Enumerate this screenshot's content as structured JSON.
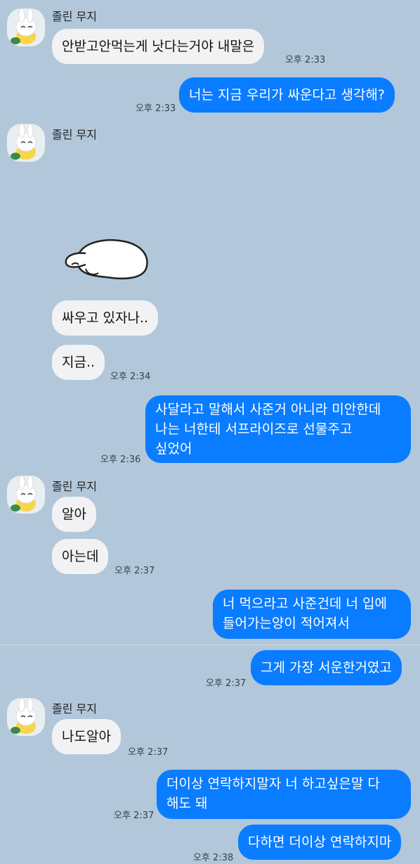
{
  "sender_name": "졸린 무지",
  "messages": {
    "m1": {
      "text": "안받고안먹는게 낫다는거야 내말은",
      "time": "오후 2:33"
    },
    "m2": {
      "text": "너는 지금 우리가 싸운다고 생각해?",
      "time": "오후 2:33"
    },
    "m3": {
      "text": "싸우고 있자나.."
    },
    "m4": {
      "text": "지금..",
      "time": "오후 2:34"
    },
    "m5": {
      "text": "사달라고 말해서 사준거 아니라 미안한데\n나는 너한테 서프라이즈로 선물주고\n싶었어",
      "time": "오후 2:36"
    },
    "m6": {
      "text": "알아"
    },
    "m7": {
      "text": "아는데",
      "time": "오후 2:37"
    },
    "m8": {
      "text": "너 먹으라고 사준건데 너 입에\n들어가는양이 적어져서"
    },
    "m9": {
      "text": "그게 가장 서운한거였고",
      "time": "오후 2:37"
    },
    "m10": {
      "text": "나도알아",
      "time": "오후 2:37"
    },
    "m11": {
      "text": "더이상 연락하지말자 너 하고싶은말 다\n해도 돼",
      "time": "오후 2:37"
    },
    "m12": {
      "text": "다하면 더이상 연락하지마",
      "time": "오후 2:38"
    }
  },
  "colors": {
    "background": "#b2c7da",
    "incoming_bubble": "#f2f2f4",
    "outgoing_bubble": "#0a7cff"
  },
  "sticker": {
    "icon": "sleeping-muzi-sticker"
  }
}
